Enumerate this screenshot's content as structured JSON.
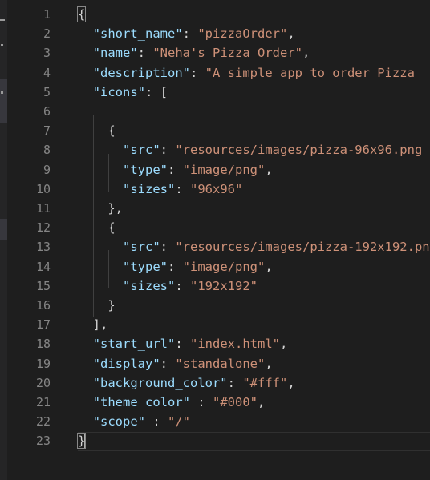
{
  "theme": {
    "background": "#1e1e1e",
    "line_number": "#858585",
    "property_key": "#9cdcfe",
    "string_value": "#ce9178",
    "punctuation": "#d4d4d4"
  },
  "editor": {
    "current_line": 23,
    "lines": [
      {
        "num": "1",
        "tokens": [
          {
            "t": "p",
            "v": "{"
          }
        ]
      },
      {
        "num": "2",
        "tokens": [
          {
            "t": "p",
            "v": "  "
          },
          {
            "t": "k",
            "v": "\"short_name\""
          },
          {
            "t": "p",
            "v": ": "
          },
          {
            "t": "s",
            "v": "\"pizzaOrder\""
          },
          {
            "t": "p",
            "v": ","
          }
        ]
      },
      {
        "num": "3",
        "tokens": [
          {
            "t": "p",
            "v": "  "
          },
          {
            "t": "k",
            "v": "\"name\""
          },
          {
            "t": "p",
            "v": ": "
          },
          {
            "t": "s",
            "v": "\"Neha's Pizza Order\""
          },
          {
            "t": "p",
            "v": ","
          }
        ]
      },
      {
        "num": "4",
        "tokens": [
          {
            "t": "p",
            "v": "  "
          },
          {
            "t": "k",
            "v": "\"description\""
          },
          {
            "t": "p",
            "v": ": "
          },
          {
            "t": "s",
            "v": "\"A simple app to order Pizza"
          }
        ]
      },
      {
        "num": "5",
        "tokens": [
          {
            "t": "p",
            "v": "  "
          },
          {
            "t": "k",
            "v": "\"icons\""
          },
          {
            "t": "p",
            "v": ": ["
          }
        ]
      },
      {
        "num": "6",
        "tokens": []
      },
      {
        "num": "7",
        "tokens": [
          {
            "t": "p",
            "v": "    {"
          }
        ]
      },
      {
        "num": "8",
        "tokens": [
          {
            "t": "p",
            "v": "      "
          },
          {
            "t": "k",
            "v": "\"src\""
          },
          {
            "t": "p",
            "v": ": "
          },
          {
            "t": "s",
            "v": "\"resources/images/pizza-96x96.png"
          }
        ]
      },
      {
        "num": "9",
        "tokens": [
          {
            "t": "p",
            "v": "      "
          },
          {
            "t": "k",
            "v": "\"type\""
          },
          {
            "t": "p",
            "v": ": "
          },
          {
            "t": "s",
            "v": "\"image/png\""
          },
          {
            "t": "p",
            "v": ","
          }
        ]
      },
      {
        "num": "10",
        "tokens": [
          {
            "t": "p",
            "v": "      "
          },
          {
            "t": "k",
            "v": "\"sizes\""
          },
          {
            "t": "p",
            "v": ": "
          },
          {
            "t": "s",
            "v": "\"96x96\""
          }
        ]
      },
      {
        "num": "11",
        "tokens": [
          {
            "t": "p",
            "v": "    },"
          }
        ]
      },
      {
        "num": "12",
        "tokens": [
          {
            "t": "p",
            "v": "    {"
          }
        ]
      },
      {
        "num": "13",
        "tokens": [
          {
            "t": "p",
            "v": "      "
          },
          {
            "t": "k",
            "v": "\"src\""
          },
          {
            "t": "p",
            "v": ": "
          },
          {
            "t": "s",
            "v": "\"resources/images/pizza-192x192.png"
          }
        ]
      },
      {
        "num": "14",
        "tokens": [
          {
            "t": "p",
            "v": "      "
          },
          {
            "t": "k",
            "v": "\"type\""
          },
          {
            "t": "p",
            "v": ": "
          },
          {
            "t": "s",
            "v": "\"image/png\""
          },
          {
            "t": "p",
            "v": ","
          }
        ]
      },
      {
        "num": "15",
        "tokens": [
          {
            "t": "p",
            "v": "      "
          },
          {
            "t": "k",
            "v": "\"sizes\""
          },
          {
            "t": "p",
            "v": ": "
          },
          {
            "t": "s",
            "v": "\"192x192\""
          }
        ]
      },
      {
        "num": "16",
        "tokens": [
          {
            "t": "p",
            "v": "    }"
          }
        ]
      },
      {
        "num": "17",
        "tokens": [
          {
            "t": "p",
            "v": "  ],"
          }
        ]
      },
      {
        "num": "18",
        "tokens": [
          {
            "t": "p",
            "v": "  "
          },
          {
            "t": "k",
            "v": "\"start_url\""
          },
          {
            "t": "p",
            "v": ": "
          },
          {
            "t": "s",
            "v": "\"index.html\""
          },
          {
            "t": "p",
            "v": ","
          }
        ]
      },
      {
        "num": "19",
        "tokens": [
          {
            "t": "p",
            "v": "  "
          },
          {
            "t": "k",
            "v": "\"display\""
          },
          {
            "t": "p",
            "v": ": "
          },
          {
            "t": "s",
            "v": "\"standalone\""
          },
          {
            "t": "p",
            "v": ","
          }
        ]
      },
      {
        "num": "20",
        "tokens": [
          {
            "t": "p",
            "v": "  "
          },
          {
            "t": "k",
            "v": "\"background_color\""
          },
          {
            "t": "p",
            "v": ": "
          },
          {
            "t": "s",
            "v": "\"#fff\""
          },
          {
            "t": "p",
            "v": ","
          }
        ]
      },
      {
        "num": "21",
        "tokens": [
          {
            "t": "p",
            "v": "  "
          },
          {
            "t": "k",
            "v": "\"theme_color\""
          },
          {
            "t": "p",
            "v": " : "
          },
          {
            "t": "s",
            "v": "\"#000\""
          },
          {
            "t": "p",
            "v": ","
          }
        ]
      },
      {
        "num": "22",
        "tokens": [
          {
            "t": "p",
            "v": "  "
          },
          {
            "t": "k",
            "v": "\"scope\""
          },
          {
            "t": "p",
            "v": " : "
          },
          {
            "t": "s",
            "v": "\"/\""
          }
        ]
      },
      {
        "num": "23",
        "tokens": [
          {
            "t": "p",
            "v": "}"
          }
        ]
      }
    ]
  }
}
